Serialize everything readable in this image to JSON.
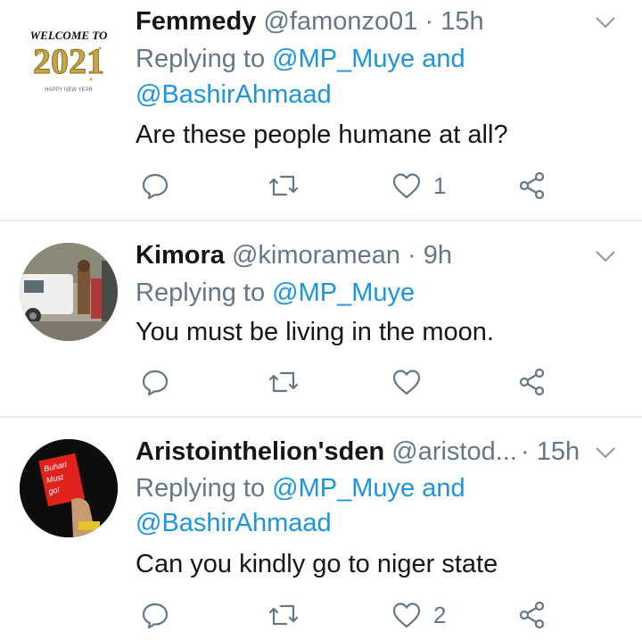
{
  "tweets": [
    {
      "name": "Femmedy",
      "handle": "@famonzo01",
      "separator": "·",
      "time": "15h",
      "replying_prefix": "Replying to",
      "mentions_line1": "@MP_Muye and",
      "mentions_line2": "@BashirAhmaad",
      "text": "Are these people humane at all?",
      "like_count": "1",
      "avatar_text": "WELCOME TO",
      "avatar_year": "2021",
      "avatar_sub": "HAPPY NEW YEAR"
    },
    {
      "name": "Kimora",
      "handle": "@kimoramean",
      "separator": "·",
      "time": "9h",
      "replying_prefix": "Replying to",
      "mentions_line1": "@MP_Muye",
      "text": "You must be living in the moon.",
      "like_count": ""
    },
    {
      "name": "Aristointhelion'sden",
      "handle": "@aristod...",
      "separator": "·",
      "time": "15h",
      "replying_prefix": "Replying to",
      "mentions_line1": "@MP_Muye and",
      "mentions_line2": "@BashirAhmaad",
      "text": "Can you kindly go to niger state",
      "like_count": "2",
      "avatar_text": "Buhari Must go!"
    }
  ],
  "colors": {
    "text": "#14171a",
    "secondary": "#657786",
    "link": "#1b95e0",
    "divider": "#e6ecf0"
  },
  "icons": [
    "reply-icon",
    "retweet-icon",
    "like-icon",
    "share-icon",
    "caret-down-icon"
  ]
}
